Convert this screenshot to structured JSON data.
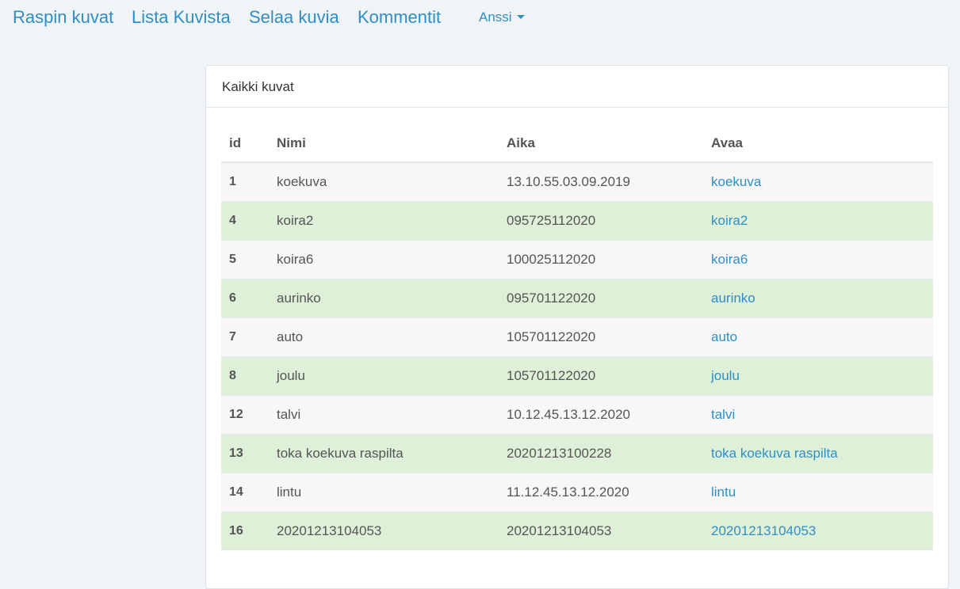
{
  "nav": {
    "links": [
      "Raspin kuvat",
      "Lista Kuvista",
      "Selaa kuvia",
      "Kommentit"
    ],
    "user": "Anssi"
  },
  "panel": {
    "title": "Kaikki kuvat"
  },
  "table": {
    "headers": [
      "id",
      "Nimi",
      "Aika",
      "Avaa"
    ],
    "rows": [
      {
        "id": "1",
        "name": "koekuva",
        "time": "13.10.55.03.09.2019",
        "link": "koekuva"
      },
      {
        "id": "4",
        "name": "koira2",
        "time": "095725112020",
        "link": "koira2"
      },
      {
        "id": "5",
        "name": "koira6",
        "time": "100025112020",
        "link": "koira6"
      },
      {
        "id": "6",
        "name": "aurinko",
        "time": "095701122020",
        "link": "aurinko"
      },
      {
        "id": "7",
        "name": "auto",
        "time": "105701122020",
        "link": "auto"
      },
      {
        "id": "8",
        "name": "joulu",
        "time": "105701122020",
        "link": "joulu"
      },
      {
        "id": "12",
        "name": "talvi",
        "time": "10.12.45.13.12.2020",
        "link": "talvi"
      },
      {
        "id": "13",
        "name": "toka koekuva raspilta",
        "time": "20201213100228",
        "link": "toka koekuva raspilta"
      },
      {
        "id": "14",
        "name": "lintu",
        "time": "11.12.45.13.12.2020",
        "link": "lintu"
      },
      {
        "id": "16",
        "name": "20201213104053",
        "time": "20201213104053",
        "link": "20201213104053"
      }
    ]
  },
  "colors": {
    "link": "#2f8fc4",
    "background": "#f0f4f7",
    "row_success": "#dff0d8",
    "row_stripe": "#f7f7f7"
  }
}
